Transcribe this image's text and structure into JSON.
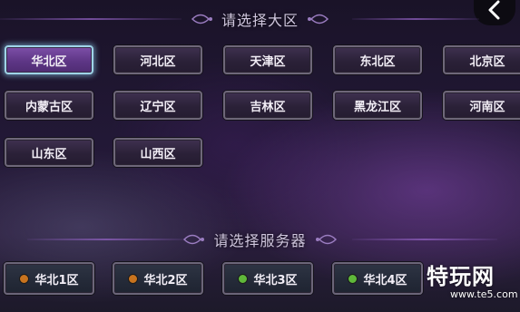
{
  "region_section": {
    "title": "请选择大区"
  },
  "server_section": {
    "title": "请选择服务器"
  },
  "regions": [
    {
      "label": "华北区",
      "selected": true
    },
    {
      "label": "河北区",
      "selected": false
    },
    {
      "label": "天津区",
      "selected": false
    },
    {
      "label": "东北区",
      "selected": false
    },
    {
      "label": "北京区",
      "selected": false
    },
    {
      "label": "内蒙古区",
      "selected": false
    },
    {
      "label": "辽宁区",
      "selected": false
    },
    {
      "label": "吉林区",
      "selected": false
    },
    {
      "label": "黑龙江区",
      "selected": false
    },
    {
      "label": "河南区",
      "selected": false
    },
    {
      "label": "山东区",
      "selected": false
    },
    {
      "label": "山西区",
      "selected": false
    }
  ],
  "servers": [
    {
      "label": "华北1区",
      "status_color": "#c8731e"
    },
    {
      "label": "华北2区",
      "status_color": "#c8731e"
    },
    {
      "label": "华北3区",
      "status_color": "#5fb83a"
    },
    {
      "label": "华北4区",
      "status_color": "#5fb83a"
    }
  ],
  "back_button": {
    "icon": "chevron-left-icon"
  },
  "watermark": {
    "logo_text": "特玩网",
    "site": "www.te5.com"
  },
  "colors": {
    "selected_border": "#9fd4e8",
    "selected_fill": "#6a3f94",
    "status_busy": "#c8731e",
    "status_good": "#5fb83a"
  }
}
